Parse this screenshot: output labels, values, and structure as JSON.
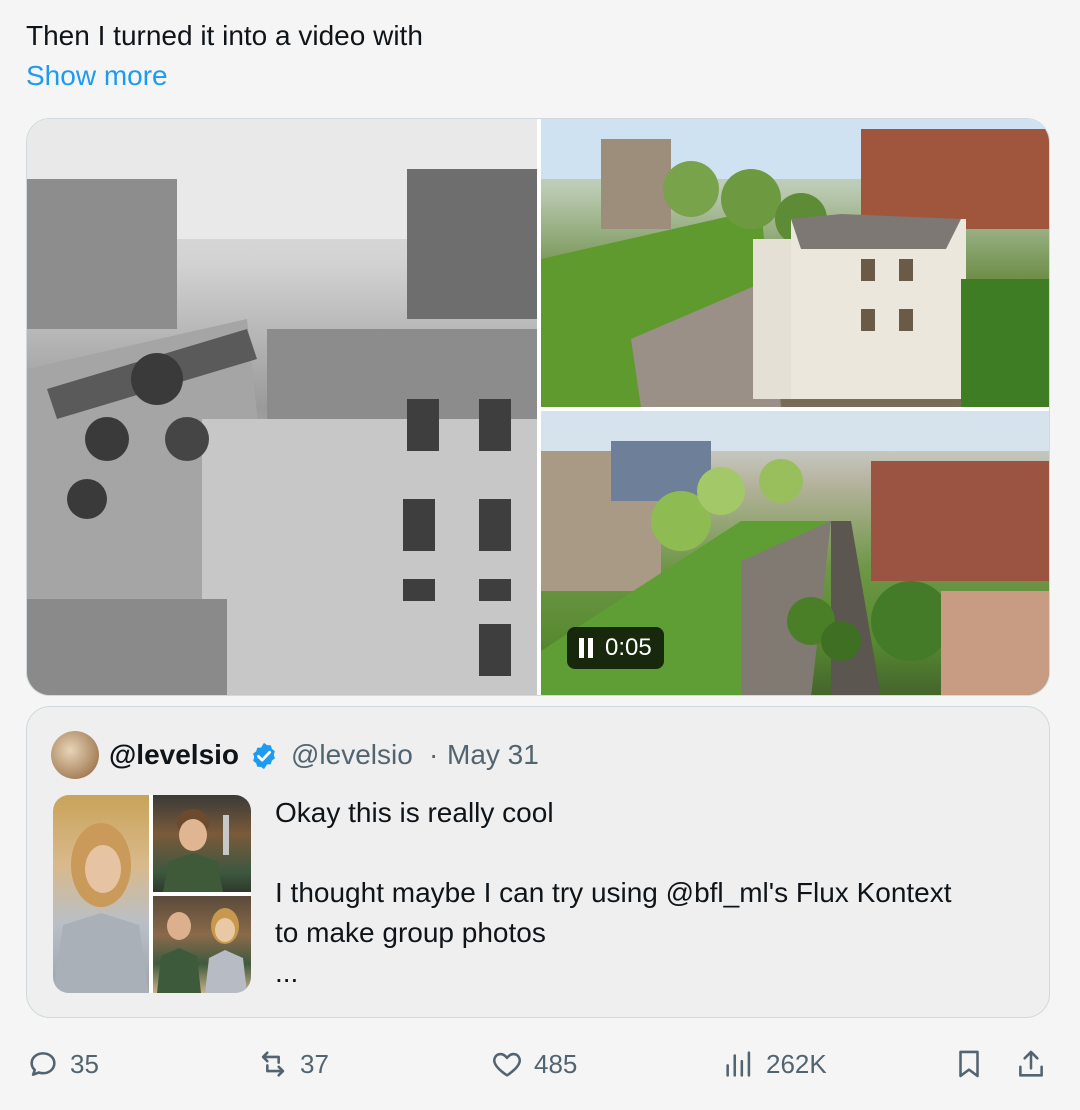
{
  "tweet": {
    "text": "Then I turned it into a video with",
    "show_more": "Show more"
  },
  "media": {
    "video_time": "0:05"
  },
  "quote": {
    "display_name": "@levelsio",
    "handle": "@levelsio",
    "separator": "·",
    "date": "May 31",
    "lines": [
      "Okay this is really cool",
      "",
      "I thought maybe I can try using @bfl_ml's Flux Kontext",
      "to make group photos",
      "..."
    ]
  },
  "actions": {
    "replies": "35",
    "reposts": "37",
    "likes": "485",
    "views": "262K"
  },
  "colors": {
    "accent": "#1d9bf0",
    "secondary_text": "#536471"
  }
}
